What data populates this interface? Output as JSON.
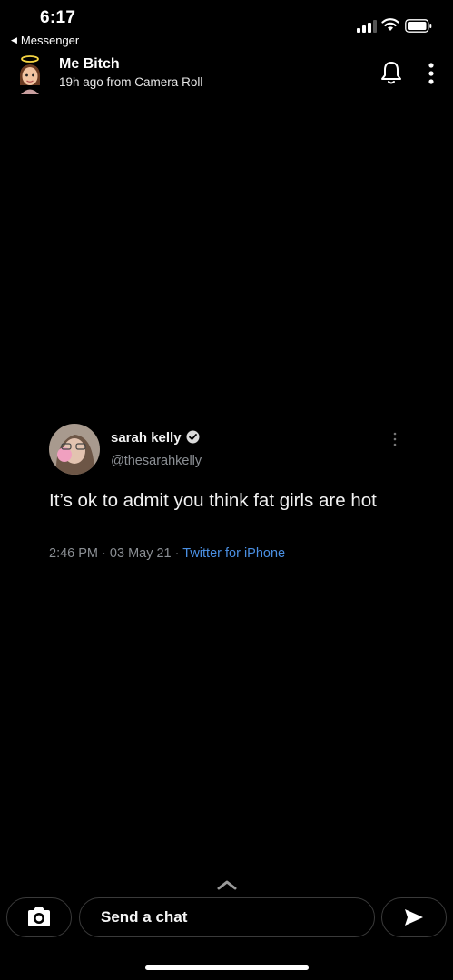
{
  "status_bar": {
    "time": "6:17",
    "back_app": "Messenger",
    "icons": [
      "signal-icon",
      "wifi-icon",
      "battery-icon"
    ]
  },
  "story": {
    "title": "Me Bitch",
    "subtitle": "19h ago from Camera Roll",
    "icons": [
      "avatar",
      "bell-icon",
      "more-vertical-icon"
    ]
  },
  "tweet": {
    "name": "sarah kelly",
    "handle": "@thesarahkelly",
    "text": "It’s ok to admit you think fat girls are hot",
    "time": "2:46 PM",
    "date": "03 May 21",
    "separator": "·",
    "source": "Twitter for iPhone",
    "verified": true,
    "colors": {
      "source_link": "#4a8fe2",
      "muted": "#8b8f94"
    }
  },
  "composer": {
    "placeholder": "Send a chat",
    "icons": [
      "camera-icon",
      "send-icon",
      "chevron-up-icon"
    ]
  }
}
